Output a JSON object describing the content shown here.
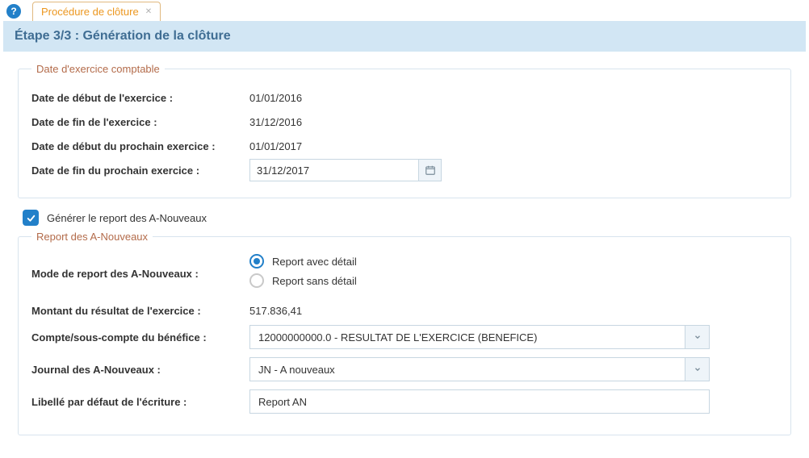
{
  "tab": {
    "title": "Procédure de clôture"
  },
  "step": {
    "title": "Étape 3/3 : Génération de la clôture"
  },
  "fiscal": {
    "legend": "Date d'exercice comptable",
    "start_label": "Date de début de l'exercice :",
    "start_value": "01/01/2016",
    "end_label": "Date de fin de l'exercice :",
    "end_value": "31/12/2016",
    "next_start_label": "Date de début du prochain exercice :",
    "next_start_value": "01/01/2017",
    "next_end_label": "Date de fin du prochain exercice :",
    "next_end_value": "31/12/2017"
  },
  "generate": {
    "label": "Générer le report des A-Nouveaux",
    "checked": true
  },
  "report": {
    "legend": "Report des A-Nouveaux",
    "mode_label": "Mode de report des A-Nouveaux :",
    "mode_with_detail": "Report avec détail",
    "mode_without_detail": "Report sans détail",
    "amount_label": "Montant du résultat de l'exercice :",
    "amount_value": "517.836,41",
    "account_label": "Compte/sous-compte du bénéfice :",
    "account_value": "12000000000.0 - RESULTAT DE L'EXERCICE (BENEFICE)",
    "journal_label": "Journal des A-Nouveaux :",
    "journal_value": "JN - A nouveaux",
    "libelle_label": "Libellé par défaut de l'écriture :",
    "libelle_value": "Report AN"
  }
}
